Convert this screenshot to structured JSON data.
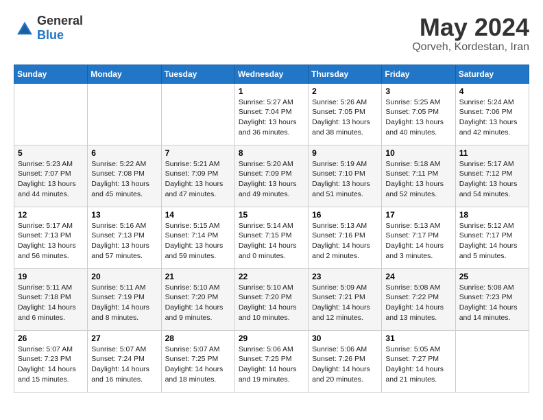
{
  "header": {
    "logo_general": "General",
    "logo_blue": "Blue",
    "month": "May 2024",
    "location": "Qorveh, Kordestan, Iran"
  },
  "days_of_week": [
    "Sunday",
    "Monday",
    "Tuesday",
    "Wednesday",
    "Thursday",
    "Friday",
    "Saturday"
  ],
  "weeks": [
    [
      {
        "day": "",
        "info": ""
      },
      {
        "day": "",
        "info": ""
      },
      {
        "day": "",
        "info": ""
      },
      {
        "day": "1",
        "info": "Sunrise: 5:27 AM\nSunset: 7:04 PM\nDaylight: 13 hours and 36 minutes."
      },
      {
        "day": "2",
        "info": "Sunrise: 5:26 AM\nSunset: 7:05 PM\nDaylight: 13 hours and 38 minutes."
      },
      {
        "day": "3",
        "info": "Sunrise: 5:25 AM\nSunset: 7:05 PM\nDaylight: 13 hours and 40 minutes."
      },
      {
        "day": "4",
        "info": "Sunrise: 5:24 AM\nSunset: 7:06 PM\nDaylight: 13 hours and 42 minutes."
      }
    ],
    [
      {
        "day": "5",
        "info": "Sunrise: 5:23 AM\nSunset: 7:07 PM\nDaylight: 13 hours and 44 minutes."
      },
      {
        "day": "6",
        "info": "Sunrise: 5:22 AM\nSunset: 7:08 PM\nDaylight: 13 hours and 45 minutes."
      },
      {
        "day": "7",
        "info": "Sunrise: 5:21 AM\nSunset: 7:09 PM\nDaylight: 13 hours and 47 minutes."
      },
      {
        "day": "8",
        "info": "Sunrise: 5:20 AM\nSunset: 7:09 PM\nDaylight: 13 hours and 49 minutes."
      },
      {
        "day": "9",
        "info": "Sunrise: 5:19 AM\nSunset: 7:10 PM\nDaylight: 13 hours and 51 minutes."
      },
      {
        "day": "10",
        "info": "Sunrise: 5:18 AM\nSunset: 7:11 PM\nDaylight: 13 hours and 52 minutes."
      },
      {
        "day": "11",
        "info": "Sunrise: 5:17 AM\nSunset: 7:12 PM\nDaylight: 13 hours and 54 minutes."
      }
    ],
    [
      {
        "day": "12",
        "info": "Sunrise: 5:17 AM\nSunset: 7:13 PM\nDaylight: 13 hours and 56 minutes."
      },
      {
        "day": "13",
        "info": "Sunrise: 5:16 AM\nSunset: 7:13 PM\nDaylight: 13 hours and 57 minutes."
      },
      {
        "day": "14",
        "info": "Sunrise: 5:15 AM\nSunset: 7:14 PM\nDaylight: 13 hours and 59 minutes."
      },
      {
        "day": "15",
        "info": "Sunrise: 5:14 AM\nSunset: 7:15 PM\nDaylight: 14 hours and 0 minutes."
      },
      {
        "day": "16",
        "info": "Sunrise: 5:13 AM\nSunset: 7:16 PM\nDaylight: 14 hours and 2 minutes."
      },
      {
        "day": "17",
        "info": "Sunrise: 5:13 AM\nSunset: 7:17 PM\nDaylight: 14 hours and 3 minutes."
      },
      {
        "day": "18",
        "info": "Sunrise: 5:12 AM\nSunset: 7:17 PM\nDaylight: 14 hours and 5 minutes."
      }
    ],
    [
      {
        "day": "19",
        "info": "Sunrise: 5:11 AM\nSunset: 7:18 PM\nDaylight: 14 hours and 6 minutes."
      },
      {
        "day": "20",
        "info": "Sunrise: 5:11 AM\nSunset: 7:19 PM\nDaylight: 14 hours and 8 minutes."
      },
      {
        "day": "21",
        "info": "Sunrise: 5:10 AM\nSunset: 7:20 PM\nDaylight: 14 hours and 9 minutes."
      },
      {
        "day": "22",
        "info": "Sunrise: 5:10 AM\nSunset: 7:20 PM\nDaylight: 14 hours and 10 minutes."
      },
      {
        "day": "23",
        "info": "Sunrise: 5:09 AM\nSunset: 7:21 PM\nDaylight: 14 hours and 12 minutes."
      },
      {
        "day": "24",
        "info": "Sunrise: 5:08 AM\nSunset: 7:22 PM\nDaylight: 14 hours and 13 minutes."
      },
      {
        "day": "25",
        "info": "Sunrise: 5:08 AM\nSunset: 7:23 PM\nDaylight: 14 hours and 14 minutes."
      }
    ],
    [
      {
        "day": "26",
        "info": "Sunrise: 5:07 AM\nSunset: 7:23 PM\nDaylight: 14 hours and 15 minutes."
      },
      {
        "day": "27",
        "info": "Sunrise: 5:07 AM\nSunset: 7:24 PM\nDaylight: 14 hours and 16 minutes."
      },
      {
        "day": "28",
        "info": "Sunrise: 5:07 AM\nSunset: 7:25 PM\nDaylight: 14 hours and 18 minutes."
      },
      {
        "day": "29",
        "info": "Sunrise: 5:06 AM\nSunset: 7:25 PM\nDaylight: 14 hours and 19 minutes."
      },
      {
        "day": "30",
        "info": "Sunrise: 5:06 AM\nSunset: 7:26 PM\nDaylight: 14 hours and 20 minutes."
      },
      {
        "day": "31",
        "info": "Sunrise: 5:05 AM\nSunset: 7:27 PM\nDaylight: 14 hours and 21 minutes."
      },
      {
        "day": "",
        "info": ""
      }
    ]
  ]
}
